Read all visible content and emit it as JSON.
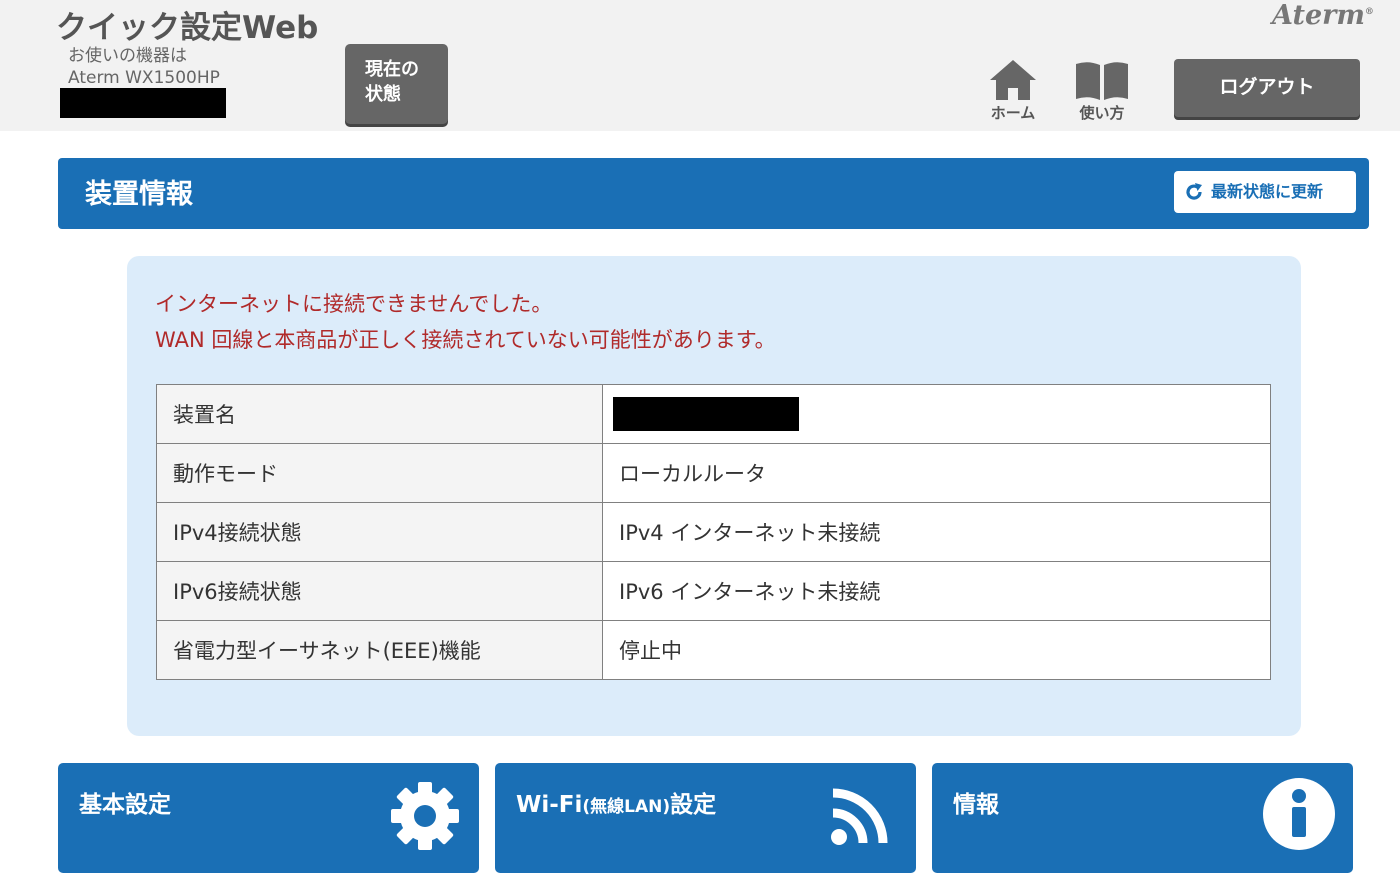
{
  "header": {
    "app_title": "クイック設定Web",
    "device_caption": "お使いの機器は",
    "device_model": "Aterm WX1500HP",
    "status_button_line1": "現在の",
    "status_button_line2": "状態",
    "brand": "Aterm",
    "brand_mark": "®",
    "home_label": "ホーム",
    "guide_label": "使い方",
    "logout_label": "ログアウト"
  },
  "section": {
    "title": "装置情報",
    "refresh_label": "最新状態に更新"
  },
  "warning": {
    "line1": "インターネットに接続できませんでした。",
    "line2": "WAN 回線と本商品が正しく接続されていない可能性があります。"
  },
  "table": {
    "rows": [
      {
        "label": "装置名",
        "value": ""
      },
      {
        "label": "動作モード",
        "value": "ローカルルータ"
      },
      {
        "label": "IPv4接続状態",
        "value": "IPv4 インターネット未接続"
      },
      {
        "label": "IPv6接続状態",
        "value": "IPv6 インターネット未接続"
      },
      {
        "label": "省電力型イーサネット(EEE)機能",
        "value": "停止中"
      }
    ]
  },
  "cards": {
    "basic": {
      "title": "基本設定",
      "icon": "gear-icon"
    },
    "wifi": {
      "title_main": "Wi-Fi",
      "title_small": "(無線LAN)",
      "title_end": "設定",
      "icon": "wifi-icon"
    },
    "info": {
      "title": "情報",
      "icon": "info-icon"
    }
  },
  "colors": {
    "primary_blue": "#1a6fb5",
    "warning_red": "#b02a2a",
    "panel_bg": "#dcecfa",
    "header_bg": "#f2f2f2",
    "button_gray": "#666666"
  }
}
